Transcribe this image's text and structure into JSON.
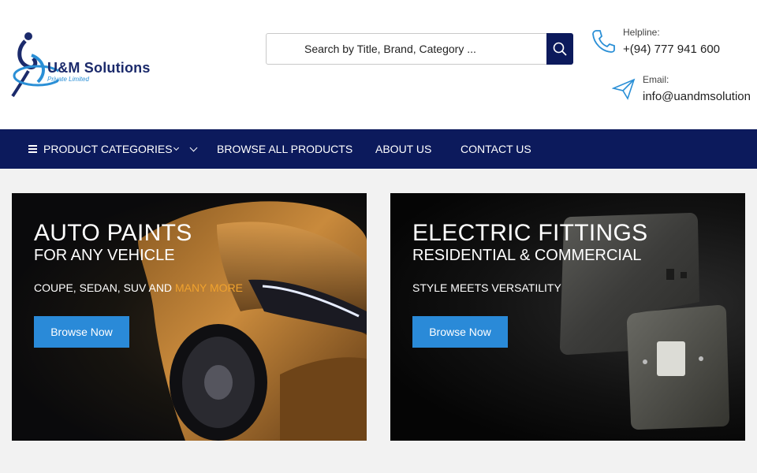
{
  "brand": {
    "name": "U&M Solutions",
    "subtitle": "Private Limited"
  },
  "search": {
    "placeholder": "Search by Title, Brand, Category ..."
  },
  "contacts": {
    "helpline_label": "Helpline:",
    "helpline_value": "+(94) 777 941 600",
    "email_label": "Email:",
    "email_value": "info@uandmsolution"
  },
  "nav": {
    "categories_label": "PRODUCT CATEGORIES",
    "items": [
      "BROWSE ALL PRODUCTS",
      "ABOUT US",
      "CONTACT US"
    ]
  },
  "banners": [
    {
      "title": "AUTO PAINTS",
      "subtitle": "FOR ANY VEHICLE",
      "tag": "COUPE, SEDAN, SUV AND ",
      "tag_highlight": "MANY MORE",
      "button": "Browse Now"
    },
    {
      "title": "ELECTRIC FITTINGS",
      "subtitle": "RESIDENTIAL & COMMERCIAL",
      "tag": "STYLE MEETS VERSATILITY",
      "button": "Browse Now"
    }
  ],
  "colors": {
    "navy": "#0c1a5c",
    "accent_blue": "#2a8ad8",
    "highlight_orange": "#f0a22e"
  },
  "icons": [
    "menu-icon",
    "chevron-down-icon",
    "search-icon",
    "phone-icon",
    "paper-plane-icon"
  ]
}
